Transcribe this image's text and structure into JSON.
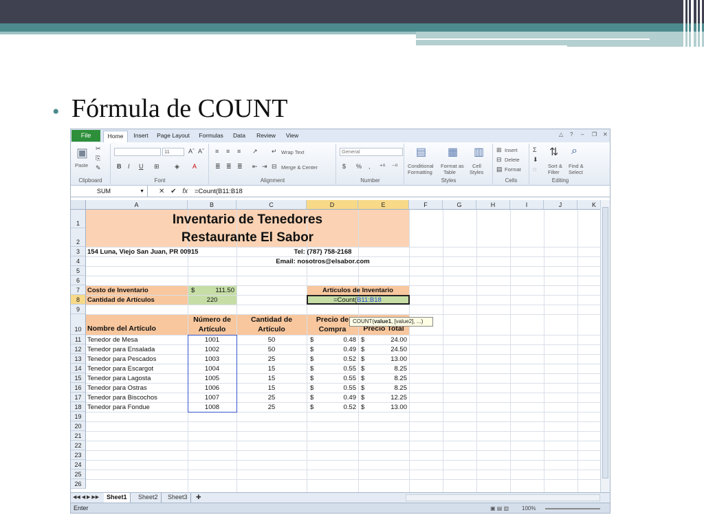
{
  "slide": {
    "bullet": "•",
    "title": "Fórmula de COUNT"
  },
  "ribbon": {
    "file_tab": "File",
    "tabs": [
      "Home",
      "Insert",
      "Page Layout",
      "Formulas",
      "Data",
      "Review",
      "View"
    ],
    "groups": {
      "clipboard": {
        "label": "Clipboard",
        "paste": "Paste"
      },
      "font": {
        "label": "Font",
        "size": "11"
      },
      "alignment": {
        "label": "Alignment",
        "wrap_text": "Wrap Text",
        "merge_center": "Merge & Center"
      },
      "number": {
        "label": "Number",
        "format": "General",
        "currency": "$",
        "percent": "%"
      },
      "styles": {
        "label": "Styles",
        "conditional": "Conditional",
        "formatting": "Formatting",
        "format_as": "Format as",
        "table": "Table",
        "cell": "Cell",
        "styles_btn": "Styles"
      },
      "cells": {
        "label": "Cells",
        "insert": "Insert",
        "delete": "Delete",
        "format": "Format"
      },
      "editing": {
        "label": "Editing",
        "sort": "Sort &",
        "filter": "Filter",
        "find": "Find &",
        "select": "Select"
      }
    }
  },
  "formula_bar": {
    "name_box": "SUM",
    "formula": "=Count(B11:B18"
  },
  "columns": [
    "A",
    "B",
    "C",
    "D",
    "E",
    "F",
    "G",
    "H",
    "I",
    "J",
    "K"
  ],
  "rows": [
    "1",
    "2",
    "3",
    "4",
    "5",
    "6",
    "7",
    "8",
    "9",
    "10",
    "11",
    "12",
    "13",
    "14",
    "15",
    "16",
    "17",
    "18",
    "19",
    "20",
    "21",
    "22",
    "23",
    "24",
    "25",
    "26"
  ],
  "sheet": {
    "title1": "Inventario de Tenedores",
    "title2": "Restaurante El Sabor",
    "address": "154 Luna, Viejo San Juan, PR 00915",
    "phone": "Tel: (787) 758-2168",
    "email": "Email: nosotros@elsabor.com",
    "costo_label": "Costo de Inventario",
    "costo_currency": "$",
    "costo_value": "111.50",
    "cantidad_label": "Cantidad de Artículos",
    "cantidad_value": "220",
    "articulos_label": "Artículos de Inventario",
    "editing_prefix": "=Count(",
    "editing_range": "B11:B18",
    "tooltip_fn": "COUNT(",
    "tooltip_arg1": "value1",
    "tooltip_rest": ", [value2], ...)",
    "headers": {
      "nombre": "Nombre del Artículo",
      "numero": "Número de Artículo",
      "cantidad": "Cantidad de Artículo",
      "precio_compra": "Precio de Compra",
      "precio_total": "Precio Total"
    },
    "items": [
      {
        "nombre": "Tenedor de Mesa",
        "numero": "1001",
        "cantidad": "50",
        "precio": "0.48",
        "total": "24.00"
      },
      {
        "nombre": "Tenedor para Ensalada",
        "numero": "1002",
        "cantidad": "50",
        "precio": "0.49",
        "total": "24.50"
      },
      {
        "nombre": "Tenedor para Pescados",
        "numero": "1003",
        "cantidad": "25",
        "precio": "0.52",
        "total": "13.00"
      },
      {
        "nombre": "Tenedor para Escargot",
        "numero": "1004",
        "cantidad": "15",
        "precio": "0.55",
        "total": "8.25"
      },
      {
        "nombre": "Tenedor para Lagosta",
        "numero": "1005",
        "cantidad": "15",
        "precio": "0.55",
        "total": "8.25"
      },
      {
        "nombre": "Tenedor para Ostras",
        "numero": "1006",
        "cantidad": "15",
        "precio": "0.55",
        "total": "8.25"
      },
      {
        "nombre": "Tenedor para Biscochos",
        "numero": "1007",
        "cantidad": "25",
        "precio": "0.49",
        "total": "12.25"
      },
      {
        "nombre": "Tenedor para Fondue",
        "numero": "1008",
        "cantidad": "25",
        "precio": "0.52",
        "total": "13.00"
      }
    ],
    "currency": "$"
  },
  "sheet_tabs": [
    "Sheet1",
    "Sheet2",
    "Sheet3"
  ],
  "status": {
    "mode": "Enter",
    "zoom": "100%"
  },
  "colors": {
    "title_fill": "#fbd3b4",
    "label_fill": "#f8c79e",
    "value_fill": "#c6dea6",
    "selected_header": "#f7d988"
  }
}
